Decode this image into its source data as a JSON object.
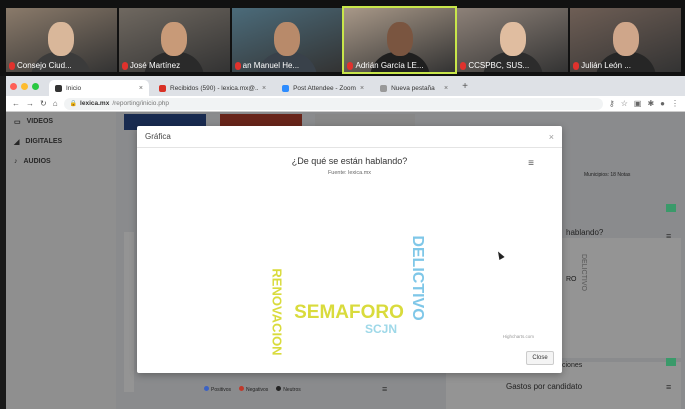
{
  "participants": [
    {
      "name": "Consejo Ciud...",
      "bg": "#8a7a6a",
      "skin": "#d9b79a",
      "shirt": "#3b3b3b",
      "active": false
    },
    {
      "name": "José Martínez",
      "bg": "#6f6860",
      "skin": "#c89a78",
      "shirt": "#2a2a2a",
      "active": false
    },
    {
      "name": "an Manuel He...",
      "bg": "#4b6b7a",
      "skin": "#b88a6a",
      "shirt": "#39414a",
      "active": false
    },
    {
      "name": "Adrián García LE...",
      "bg": "#a89888",
      "skin": "#7a5540",
      "shirt": "#1f1f1f",
      "active": true
    },
    {
      "name": "CCSPBC, SUS...",
      "bg": "#8d8178",
      "skin": "#e0bda0",
      "shirt": "#2c2c2c",
      "active": false
    },
    {
      "name": "Julián León ...",
      "bg": "#6e5e55",
      "skin": "#cfa68a",
      "shirt": "#262626",
      "active": false
    }
  ],
  "browser": {
    "tabs": [
      {
        "label": "Inicio",
        "active": true,
        "color": "#333"
      },
      {
        "label": "Recibidos (590) - lexica.mx@...",
        "active": false,
        "color": "#d93025"
      },
      {
        "label": "Post Attendee - Zoom",
        "active": false,
        "color": "#2d8cff"
      },
      {
        "label": "Nueva pestaña",
        "active": false,
        "color": "#999"
      }
    ],
    "url_host": "lexica.mx",
    "url_path": "/reporting/inicio.php",
    "newtab": "+"
  },
  "sidebar": [
    {
      "label": "VIDEOS"
    },
    {
      "label": "DIGITALES"
    },
    {
      "label": "AUDIOS"
    }
  ],
  "modal": {
    "title": "Gráfica",
    "close_x": "×",
    "close_button": "Close",
    "menu": "≡",
    "credits": "Highcharts.com"
  },
  "chart_data": {
    "type": "wordcloud",
    "title": "¿De qué se están hablando?",
    "subtitle": "Fuente: lexica.mx",
    "words": [
      {
        "text": "SEMAFORO",
        "color": "#d9db3c",
        "orientation": "horizontal"
      },
      {
        "text": "DELICTIVO",
        "color": "#7fc7e8",
        "orientation": "vertical-down"
      },
      {
        "text": "RENOVACION",
        "color": "#d9db3c",
        "orientation": "vertical-down"
      },
      {
        "text": "SCJN",
        "color": "#9ed8e8",
        "orientation": "horizontal"
      }
    ]
  },
  "background": {
    "right_title": "hablando?",
    "gastos": "Gastos por candidato",
    "municipios": "Municipios: 18 Notas",
    "ciones": "ciones",
    "legend": [
      "Positivos",
      "Negativos",
      "Neutros"
    ],
    "legend_colors": [
      "#3b62c4",
      "#c0392b",
      "#222"
    ],
    "bg_word": "DELICTIVO",
    "bg_frag": "RO"
  }
}
